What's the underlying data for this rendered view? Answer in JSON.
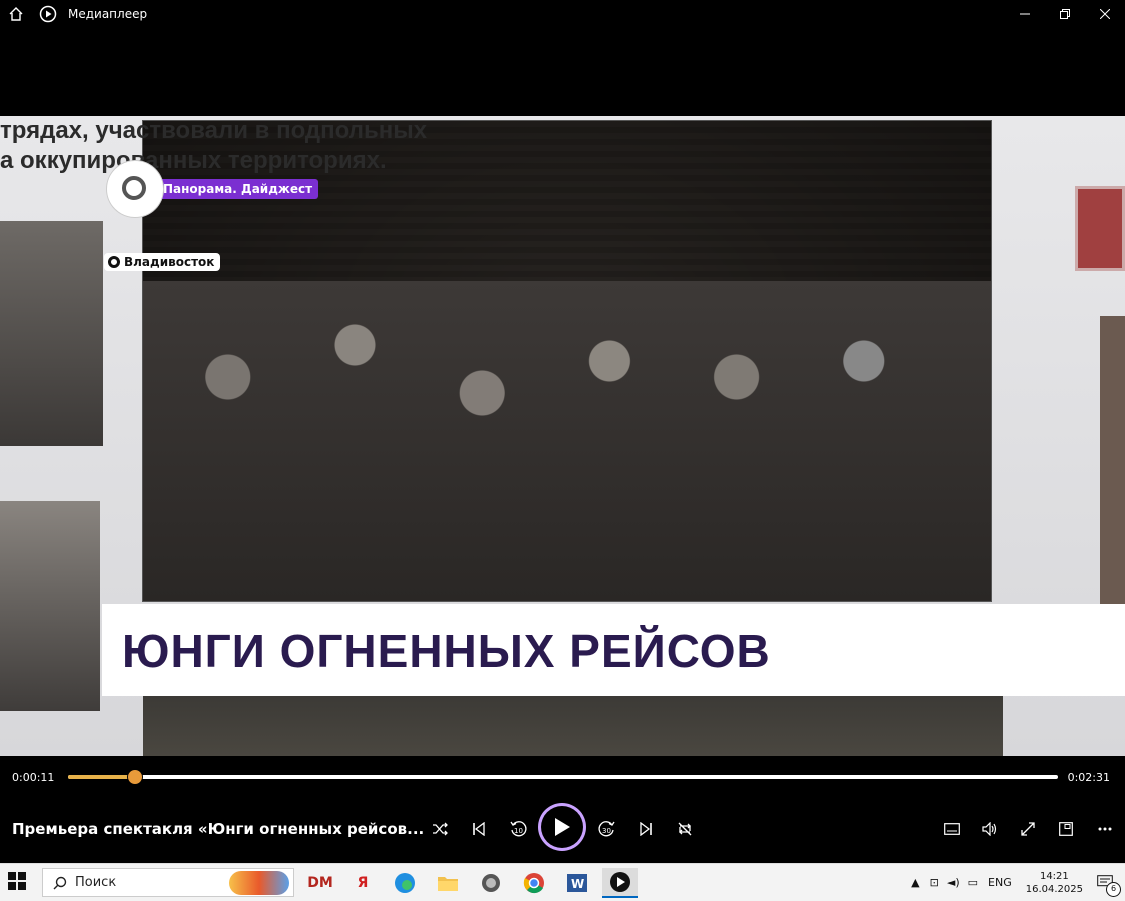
{
  "window": {
    "title": "Медиаплеер",
    "icons": [
      "home-icon",
      "media-player-icon"
    ]
  },
  "video": {
    "overlay_text_lines": [
      "трядах, участвовали в подпольных",
      "а оккупированных территориях."
    ],
    "badge_label": "Панорама. Дайджест",
    "location": "Владивосток",
    "headline": "ЮНГИ ОГНЕННЫХ РЕЙСОВ"
  },
  "player": {
    "current_time": "0:00:11",
    "total_time": "0:02:31",
    "progress_fraction": 0.068,
    "track_title": "Премьера спектакля «Юнги огненных рейсов...",
    "skip_back_label": "10",
    "skip_forward_label": "30"
  },
  "taskbar": {
    "search_placeholder": "Поиск",
    "language": "ENG",
    "time": "14:21",
    "date": "16.04.2025",
    "notifications": "6",
    "apps": [
      "DM",
      "Я"
    ]
  },
  "colors": {
    "accent": "#7b2fd1",
    "seek_fill": "#e7b24a",
    "headline": "#2a1b4f"
  }
}
